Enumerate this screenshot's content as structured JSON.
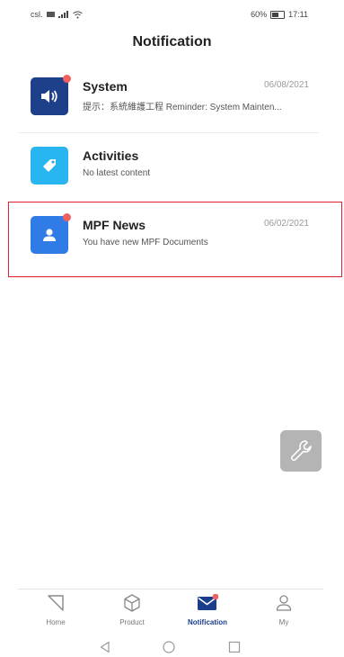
{
  "status_bar": {
    "carrier": "csl.",
    "battery": "60%",
    "time": "17:11"
  },
  "header": {
    "title": "Notification"
  },
  "notifications": [
    {
      "title": "System",
      "date": "06/08/2021",
      "subtitle": "提示：系統維護工程 Reminder: System Mainten...",
      "unread": true,
      "icon": "speaker-icon",
      "color": "#1e3f8a"
    },
    {
      "title": "Activities",
      "date": "",
      "subtitle": "No latest content",
      "unread": false,
      "icon": "tag-icon",
      "color": "#29b6f0"
    },
    {
      "title": "MPF News",
      "date": "06/02/2021",
      "subtitle": "You have new MPF Documents",
      "unread": true,
      "icon": "person-card-icon",
      "color": "#2f7ce6"
    }
  ],
  "fab": {
    "icon": "wrench-icon"
  },
  "tabs": [
    {
      "label": "Home",
      "icon": "triangle-icon"
    },
    {
      "label": "Product",
      "icon": "cube-icon"
    },
    {
      "label": "Notification",
      "icon": "envelope-icon",
      "active": true
    },
    {
      "label": "My",
      "icon": "user-icon"
    }
  ],
  "accent": "#1a3e8c",
  "unread_dot_color": "#f06060"
}
